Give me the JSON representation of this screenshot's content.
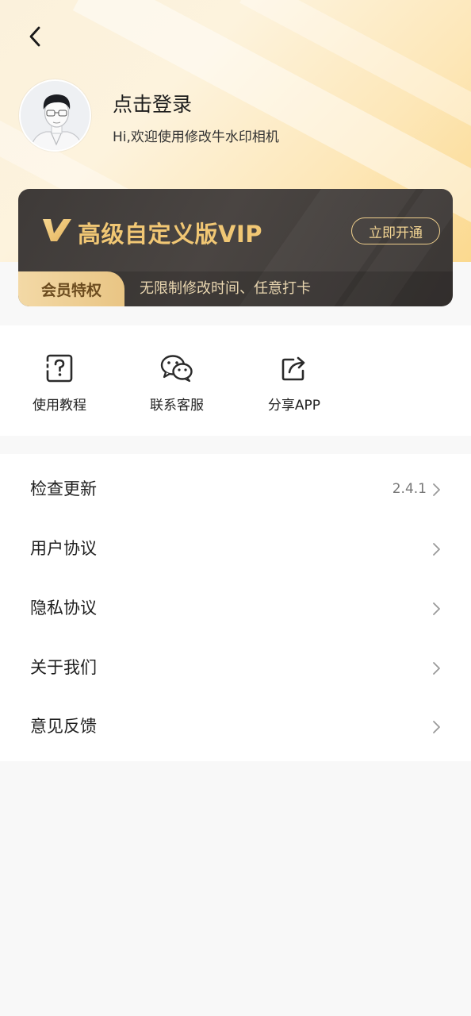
{
  "header": {
    "back_icon": "chevron-left-icon",
    "login_title": "点击登录",
    "login_subtitle": "Hi,欢迎使用修改牛水印相机"
  },
  "vip": {
    "logo_icon": "v-logo-icon",
    "title": "高级自定义版VIP",
    "open_button": "立即开通",
    "tag": "会员特权",
    "description": "无限制修改时间、任意打卡",
    "colors": {
      "gold": "#f1c774",
      "card": "#403c3a"
    }
  },
  "quick_actions": [
    {
      "label": "使用教程",
      "icon": "help-document-icon"
    },
    {
      "label": "联系客服",
      "icon": "wechat-icon"
    },
    {
      "label": "分享APP",
      "icon": "share-icon"
    }
  ],
  "settings": [
    {
      "label": "检查更新",
      "value": "2.4.1"
    },
    {
      "label": "用户协议",
      "value": ""
    },
    {
      "label": "隐私协议",
      "value": ""
    },
    {
      "label": "关于我们",
      "value": ""
    },
    {
      "label": "意见反馈",
      "value": ""
    }
  ]
}
